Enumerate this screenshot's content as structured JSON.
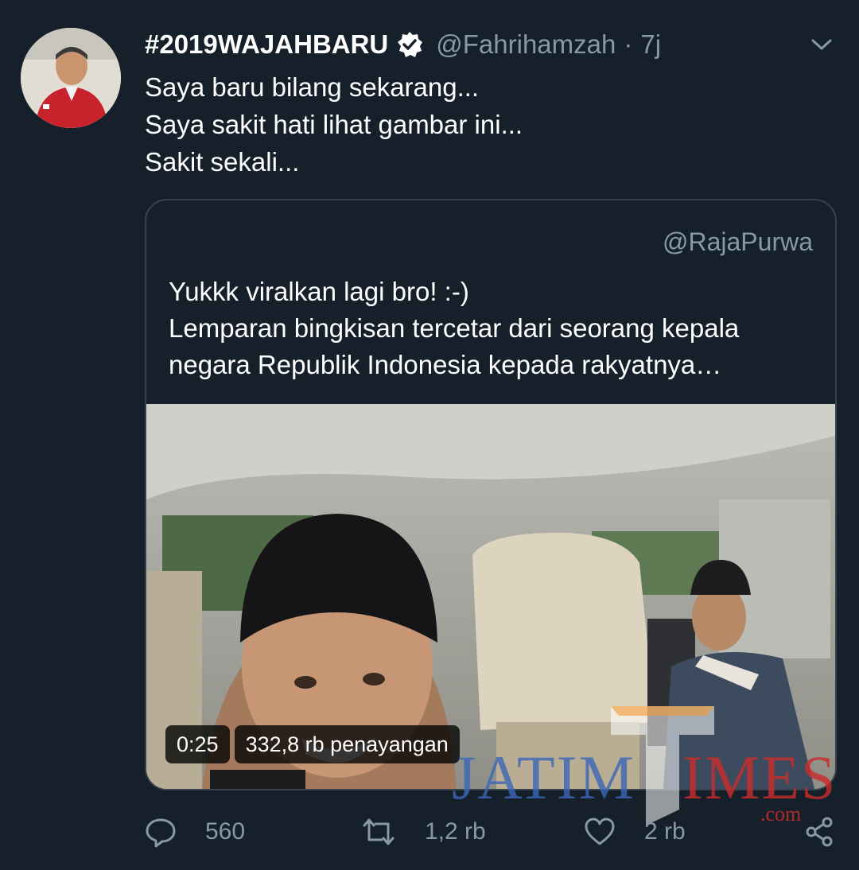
{
  "tweet": {
    "display_name": "#2019WAJAHBARU",
    "handle": "@Fahrihamzah",
    "separator": "·",
    "time": "7j",
    "text_lines": [
      "Saya baru bilang sekarang...",
      "Saya sakit hati lihat gambar ini...",
      "Sakit sekali..."
    ]
  },
  "quote": {
    "handle": "@RajaPurwa",
    "text_lines": [
      "Yukkk viralkan lagi bro! :-)",
      "Lemparan bingkisan tercetar dari seorang kepala",
      "negara Republik Indonesia kepada rakyatnya…"
    ],
    "video": {
      "duration": "0:25",
      "views": "332,8 rb penayangan"
    }
  },
  "watermark": {
    "brand": "JATIMTIMES",
    "domain": ".com"
  },
  "actions": {
    "reply_count": "560",
    "retweet_count": "1,2 rb",
    "like_count": "2 rb"
  },
  "icons": {
    "verified": "verified-badge-icon",
    "caret": "chevron-down-icon",
    "reply": "reply-bubble-icon",
    "retweet": "retweet-arrows-icon",
    "like": "heart-icon",
    "share": "share-icon"
  },
  "colors": {
    "background": "#15202b",
    "secondary_text": "#8899a6",
    "border": "#38444d",
    "primary_text": "#ffffff"
  }
}
